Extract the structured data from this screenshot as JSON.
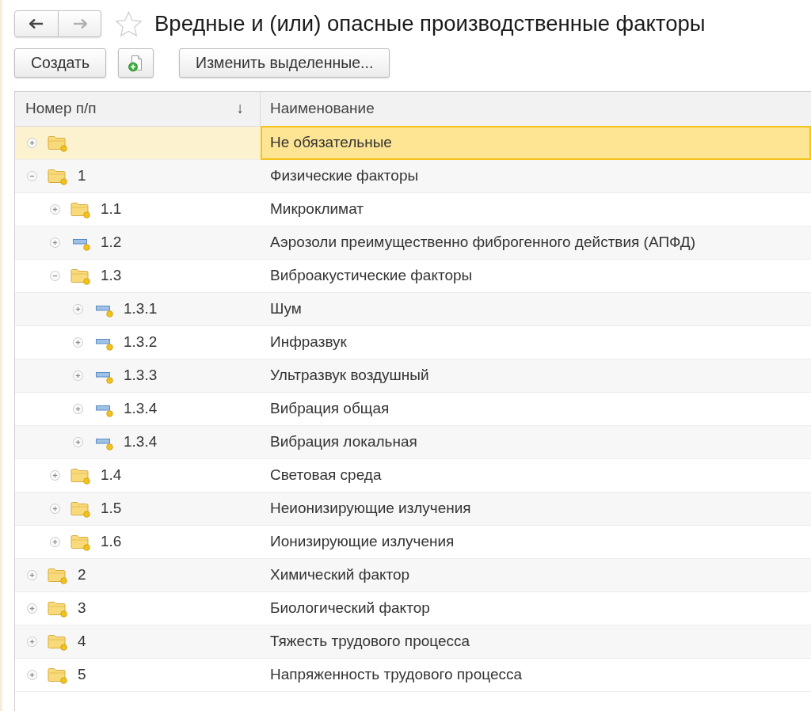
{
  "window": {
    "title": "Вредные и (или) опасные производственные факторы",
    "favorite": false
  },
  "navigation": {
    "back": {
      "disabled": false
    },
    "forward": {
      "disabled": true
    }
  },
  "toolbar": [
    {
      "kind": "text",
      "label": "Создать"
    },
    {
      "kind": "icon"
    },
    {
      "kind": "text",
      "label": "Изменить выделенные..."
    }
  ],
  "table": {
    "columns": [
      {
        "label": "Номер п/п",
        "sort_indicator": "↓"
      },
      {
        "label": "Наименование"
      }
    ],
    "rows": [
      {
        "name": "Не обязательные",
        "kind": "group",
        "expanded": false,
        "selected": true
      },
      {
        "number": "1",
        "name": "Физические факторы",
        "kind": "group",
        "expanded": true,
        "selected": false,
        "children": [
          {
            "number": "1.1",
            "name": "Микроклимат",
            "kind": "group",
            "expanded": false,
            "selected": false
          },
          {
            "number": "1.2",
            "name": "Аэрозоли преимущественно фиброгенного действия (АПФД)",
            "kind": "item",
            "expanded": false,
            "selected": false
          },
          {
            "number": "1.3",
            "name": "Виброакустические факторы",
            "kind": "group",
            "expanded": true,
            "selected": false,
            "children": [
              {
                "number": "1.3.1",
                "name": "Шум",
                "kind": "item",
                "expanded": false,
                "selected": false
              },
              {
                "number": "1.3.2",
                "name": "Инфразвук",
                "kind": "item",
                "expanded": false,
                "selected": false
              },
              {
                "number": "1.3.3",
                "name": "Ультразвук воздушный",
                "kind": "item",
                "expanded": false,
                "selected": false
              },
              {
                "number": "1.3.4",
                "name": "Вибрация общая",
                "kind": "item",
                "expanded": false,
                "selected": false
              },
              {
                "number": "1.3.4",
                "name": "Вибрация локальная",
                "kind": "item",
                "expanded": false,
                "selected": false
              }
            ]
          },
          {
            "number": "1.4",
            "name": "Световая среда",
            "kind": "group",
            "expanded": false,
            "selected": false
          },
          {
            "number": "1.5",
            "name": "Неионизирующие излучения",
            "kind": "group",
            "expanded": false,
            "selected": false
          },
          {
            "number": "1.6",
            "name": "Ионизирующие излучения",
            "kind": "group",
            "expanded": false,
            "selected": false
          }
        ]
      },
      {
        "number": "2",
        "name": "Химический фактор",
        "kind": "group",
        "expanded": false,
        "selected": false
      },
      {
        "number": "3",
        "name": "Биологический фактор",
        "kind": "group",
        "expanded": false,
        "selected": false
      },
      {
        "number": "4",
        "name": "Тяжесть трудового процесса",
        "kind": "group",
        "expanded": false,
        "selected": false
      },
      {
        "number": "5",
        "name": "Напряженность трудового процесса",
        "kind": "group",
        "expanded": false,
        "selected": false
      }
    ]
  }
}
